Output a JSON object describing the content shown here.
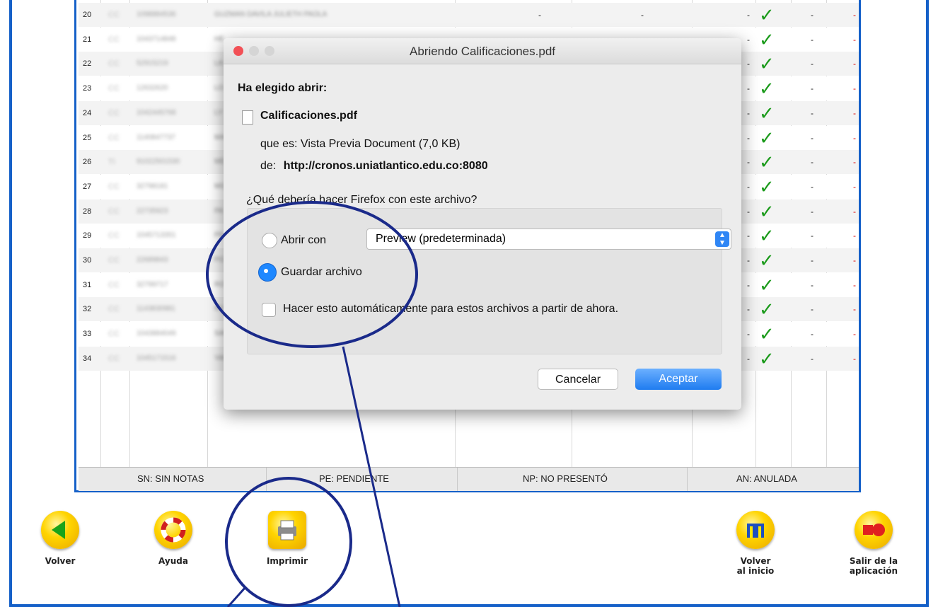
{
  "table": {
    "rows": [
      {
        "num": "20",
        "doc": "CC",
        "id": "1098884536",
        "name": "GUZMAN DAVILA JULIETH PAOLA"
      },
      {
        "num": "21",
        "doc": "CC",
        "id": "1043714848",
        "name": "HE"
      },
      {
        "num": "22",
        "doc": "CC",
        "id": "52915219",
        "name": "LA"
      },
      {
        "num": "23",
        "doc": "CC",
        "id": "12632620",
        "name": "LO"
      },
      {
        "num": "24",
        "doc": "CC",
        "id": "1042445768",
        "name": "LY"
      },
      {
        "num": "25",
        "doc": "CC",
        "id": "1140847737",
        "name": "MA"
      },
      {
        "num": "26",
        "doc": "TI",
        "id": "91022501530",
        "name": "ME"
      },
      {
        "num": "27",
        "doc": "CC",
        "id": "32798181",
        "name": "MO"
      },
      {
        "num": "28",
        "doc": "CC",
        "id": "22735923",
        "name": "PA"
      },
      {
        "num": "29",
        "doc": "CC",
        "id": "1045713351",
        "name": "PE"
      },
      {
        "num": "30",
        "doc": "CC",
        "id": "22689843",
        "name": "PO"
      },
      {
        "num": "31",
        "doc": "CC",
        "id": "32799717",
        "name": "RO"
      },
      {
        "num": "32",
        "doc": "CC",
        "id": "1143830981",
        "name": "RO"
      },
      {
        "num": "33",
        "doc": "CC",
        "id": "1043884049",
        "name": "SANCHEZ GRANADOS HAROLD JOSE"
      },
      {
        "num": "34",
        "doc": "CC",
        "id": "1045171516",
        "name": "YANCE ROJANO MARIA ALEJANDRA"
      }
    ],
    "dash": "-",
    "check": "✓",
    "legend": [
      "SN: SIN NOTAS",
      "PE: PENDIENTE",
      "NP: NO PRESENTÓ",
      "AN: ANULADA"
    ]
  },
  "dialog": {
    "title": "Abriendo Calificaciones.pdf",
    "chosen_label": "Ha elegido abrir:",
    "filename": "Calificaciones.pdf",
    "type_line": "que es:  Vista Previa Document (7,0 KB)",
    "from_prefix": "de:",
    "from_url": "http://cronos.uniatlantico.edu.co:8080",
    "question": "¿Qué debería hacer Firefox con este archivo?",
    "open_with_label": "Abrir con",
    "open_with_value": "Preview (predeterminada)",
    "save_label": "Guardar archivo",
    "auto_label": "Hacer esto automáticamente para estos archivos a partir de ahora.",
    "cancel": "Cancelar",
    "accept": "Aceptar",
    "save_selected": true
  },
  "toolbar": {
    "back": "Volver",
    "help": "Ayuda",
    "print": "Imprimir",
    "home_line1": "Volver",
    "home_line2": "al inicio",
    "exit_line1": "Salir de la",
    "exit_line2": "aplicación"
  },
  "colors": {
    "accent": "#1560c8",
    "check": "#1a9a1a",
    "button_blue": "#2f86f5",
    "annotation": "#1a2a8a"
  }
}
